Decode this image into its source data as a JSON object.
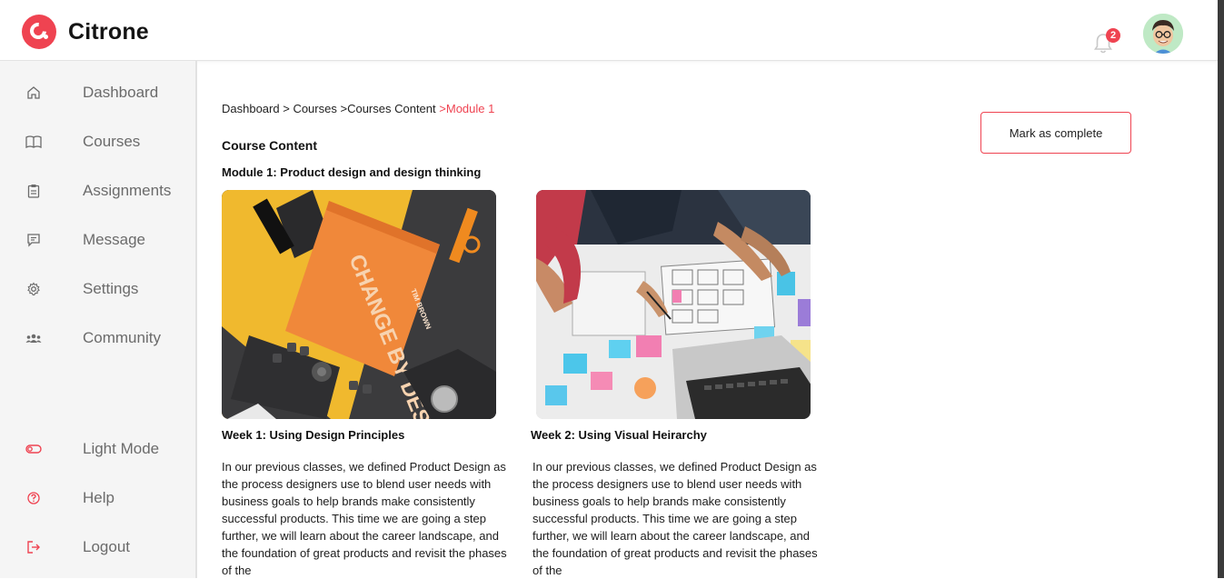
{
  "app": {
    "name": "Citrone"
  },
  "header": {
    "notification_count": "2"
  },
  "sidebar": {
    "items": [
      {
        "label": "Dashboard",
        "icon": "home-icon"
      },
      {
        "label": "Courses",
        "icon": "book-icon"
      },
      {
        "label": "Assignments",
        "icon": "clipboard-icon"
      },
      {
        "label": "Message",
        "icon": "message-icon"
      },
      {
        "label": "Settings",
        "icon": "gear-icon"
      },
      {
        "label": "Community",
        "icon": "community-icon"
      }
    ],
    "bottom": [
      {
        "label": "Light Mode",
        "icon": "toggle-icon"
      },
      {
        "label": "Help",
        "icon": "help-icon"
      },
      {
        "label": "Logout",
        "icon": "logout-icon"
      }
    ]
  },
  "breadcrumb": {
    "dashboard": "Dashboard",
    "sep1": " > ",
    "courses": "Courses",
    "sep2": " >",
    "courses_content": "Courses Content",
    "sep3": " >",
    "current": "Module 1"
  },
  "actions": {
    "mark_complete": "Mark as complete"
  },
  "content": {
    "title": "Course Content",
    "module_title": "Module 1: Product design and design thinking",
    "weeks": [
      {
        "title": "Week 1: Using Design Principles",
        "description": "In our previous classes, we defined Product Design as the process designers use to blend user needs with business goals to help brands make consistently successful products. This time we are going a step further, we will learn about the career landscape, and the foundation of great products and revisit the phases of the"
      },
      {
        "title": "Week 2: Using Visual Heirarchy",
        "description": "In our previous classes, we defined Product Design as the process designers use to blend user needs with business goals to help brands make consistently successful products. This time we are going a step further, we will learn about the career landscape, and the foundation of great products and revisit the phases of the"
      }
    ],
    "image1": {
      "book_title": "CHANGE BY DESIGN",
      "book_author": "TIM BROWN"
    }
  },
  "colors": {
    "accent": "#ef4351",
    "sidebar_bg": "#f5f5f5",
    "nav_text": "#6b6b6b"
  }
}
